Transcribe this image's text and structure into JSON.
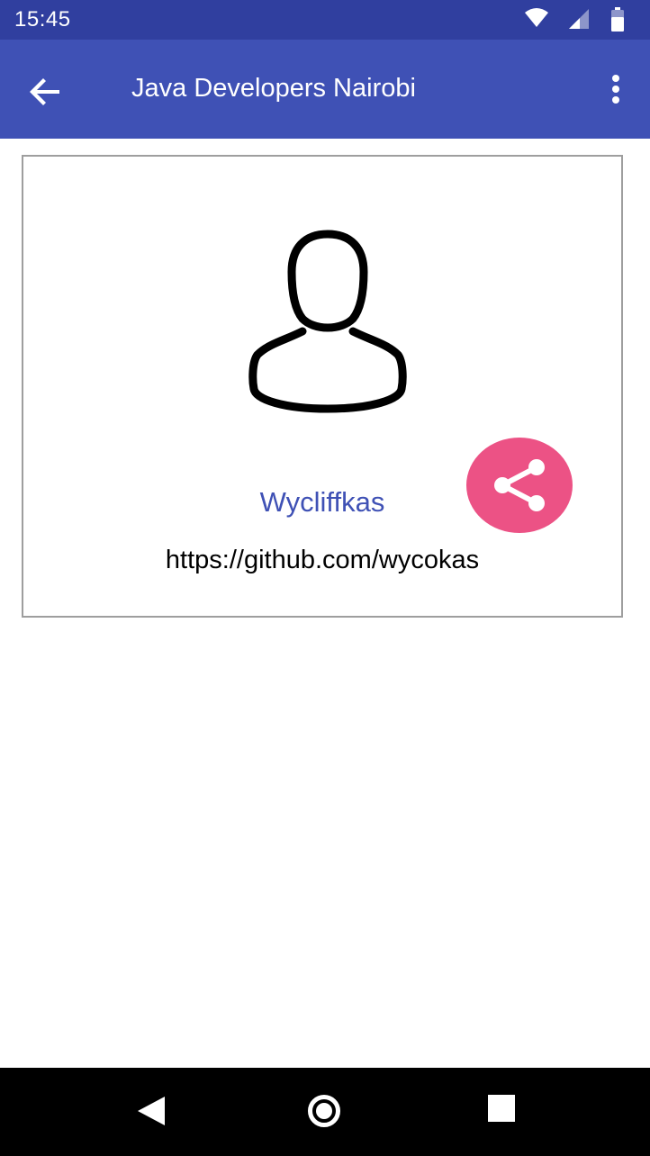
{
  "status_bar": {
    "time": "15:45",
    "icons": [
      "wifi-icon",
      "cellular-signal-icon",
      "battery-icon"
    ],
    "color": "#303f9f"
  },
  "app_bar": {
    "title": "Java Developers Nairobi",
    "back_icon": "arrow-left-icon",
    "menu_icon": "more-vert-icon",
    "color": "#3f51b5"
  },
  "profile": {
    "avatar_icon": "person-outline-icon",
    "username": "Wycliffkas",
    "url": "https://github.com/wycokas",
    "share_icon": "share-icon",
    "accent_color": "#ec5285"
  },
  "nav_bar": {
    "icons": [
      "nav-back-icon",
      "nav-home-icon",
      "nav-recents-icon"
    ]
  }
}
